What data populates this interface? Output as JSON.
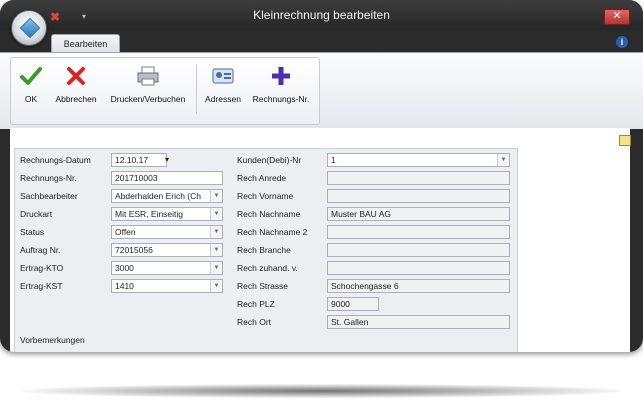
{
  "window": {
    "title": "Kleinrechnung bearbeiten",
    "close_symbol": "✕"
  },
  "ribbon": {
    "tab": "Bearbeiten",
    "buttons": [
      {
        "label": "OK",
        "icon": "checkmark-icon"
      },
      {
        "label": "Abbrechen",
        "icon": "cancel-x-icon"
      },
      {
        "label": "Drucken/Verbuchen",
        "icon": "printer-icon"
      },
      {
        "label": "Adressen",
        "icon": "address-card-icon"
      },
      {
        "label": "Rechnungs-Nr.",
        "icon": "plus-icon"
      }
    ]
  },
  "form_left": [
    {
      "label": "Rechnungs-Datum",
      "value": "12.10.17"
    },
    {
      "label": "Rechnungs-Nr.",
      "value": "201710003"
    },
    {
      "label": "Sachbearbeiter",
      "value": "Abderhalden Erich (Ch"
    },
    {
      "label": "Druckart",
      "value": "Mit ESR, Einseitig"
    },
    {
      "label": "Status",
      "value": "Offen"
    },
    {
      "label": "Auftrag Nr.",
      "value": "72015056"
    },
    {
      "label": "Ertrag-KTO",
      "value": "3000"
    },
    {
      "label": "Ertrag-KST",
      "value": "1410"
    }
  ],
  "form_right": [
    {
      "label": "Kunden(Debi)-Nr",
      "value": "1"
    },
    {
      "label": "Rech Anrede",
      "value": ""
    },
    {
      "label": "Rech Vorname",
      "value": ""
    },
    {
      "label": "Rech Nachname",
      "value": "Muster BAU AG"
    },
    {
      "label": "Rech Nachname 2",
      "value": ""
    },
    {
      "label": "Rech Branche",
      "value": ""
    },
    {
      "label": "Rech zuhand. v.",
      "value": ""
    },
    {
      "label": "Rech Strasse",
      "value": "Schochengasse 6"
    },
    {
      "label": "Rech PLZ",
      "value": "9000"
    },
    {
      "label": "Rech Ort",
      "value": "St. Gallen"
    }
  ],
  "remarks_label": "Vorbemerkungen",
  "colors": {
    "frame": "#2b2b2b",
    "panel": "#eceff2",
    "accent_close": "#c8423c"
  }
}
